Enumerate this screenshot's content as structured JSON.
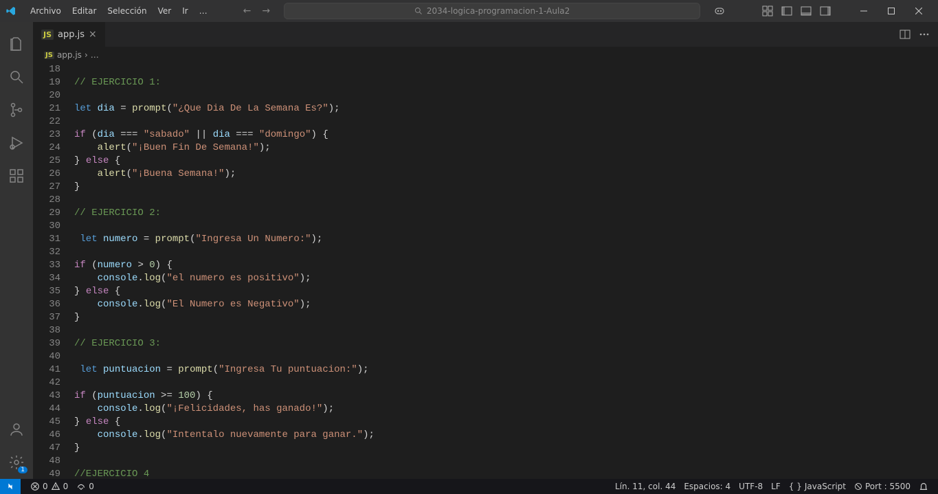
{
  "menu": [
    "Archivo",
    "Editar",
    "Selección",
    "Ver",
    "Ir",
    "…"
  ],
  "search_placeholder": "2034-logica-programacion-1-Aula2",
  "tab": {
    "label": "app.js"
  },
  "breadcrumb": {
    "file": "app.js"
  },
  "gutter_start": 18,
  "gutter_end": 49,
  "code": [
    [],
    [
      [
        "comment",
        "// EJERCICIO 1:"
      ]
    ],
    [],
    [
      [
        "keyword",
        "let"
      ],
      [
        "punct",
        " "
      ],
      [
        "var",
        "dia"
      ],
      [
        "punct",
        " = "
      ],
      [
        "func",
        "prompt"
      ],
      [
        "punct",
        "("
      ],
      [
        "string",
        "\"¿Que Dia De La Semana Es?\""
      ],
      [
        "punct",
        ");"
      ]
    ],
    [],
    [
      [
        "ctrl",
        "if"
      ],
      [
        "punct",
        " ("
      ],
      [
        "var",
        "dia"
      ],
      [
        "punct",
        " === "
      ],
      [
        "string",
        "\"sabado\""
      ],
      [
        "punct",
        " || "
      ],
      [
        "var",
        "dia"
      ],
      [
        "punct",
        " === "
      ],
      [
        "string",
        "\"domingo\""
      ],
      [
        "punct",
        ") {"
      ]
    ],
    [
      [
        "punct",
        "    "
      ],
      [
        "func",
        "alert"
      ],
      [
        "punct",
        "("
      ],
      [
        "string",
        "\"¡Buen Fin De Semana!\""
      ],
      [
        "punct",
        ");"
      ]
    ],
    [
      [
        "punct",
        "} "
      ],
      [
        "ctrl",
        "else"
      ],
      [
        "punct",
        " {"
      ]
    ],
    [
      [
        "punct",
        "    "
      ],
      [
        "func",
        "alert"
      ],
      [
        "punct",
        "("
      ],
      [
        "string",
        "\"¡Buena Semana!\""
      ],
      [
        "punct",
        ");"
      ]
    ],
    [
      [
        "punct",
        "}"
      ]
    ],
    [],
    [
      [
        "comment",
        "// EJERCICIO 2:"
      ]
    ],
    [],
    [
      [
        "punct",
        " "
      ],
      [
        "keyword",
        "let"
      ],
      [
        "punct",
        " "
      ],
      [
        "var",
        "numero"
      ],
      [
        "punct",
        " = "
      ],
      [
        "func",
        "prompt"
      ],
      [
        "punct",
        "("
      ],
      [
        "string",
        "\"Ingresa Un Numero:\""
      ],
      [
        "punct",
        ");"
      ]
    ],
    [],
    [
      [
        "ctrl",
        "if"
      ],
      [
        "punct",
        " ("
      ],
      [
        "var",
        "numero"
      ],
      [
        "punct",
        " > "
      ],
      [
        "num",
        "0"
      ],
      [
        "punct",
        ") {"
      ]
    ],
    [
      [
        "punct",
        "    "
      ],
      [
        "obj",
        "console"
      ],
      [
        "punct",
        "."
      ],
      [
        "func",
        "log"
      ],
      [
        "punct",
        "("
      ],
      [
        "string",
        "\"el numero es positivo\""
      ],
      [
        "punct",
        ");"
      ]
    ],
    [
      [
        "punct",
        "} "
      ],
      [
        "ctrl",
        "else"
      ],
      [
        "punct",
        " {"
      ]
    ],
    [
      [
        "punct",
        "    "
      ],
      [
        "obj",
        "console"
      ],
      [
        "punct",
        "."
      ],
      [
        "func",
        "log"
      ],
      [
        "punct",
        "("
      ],
      [
        "string",
        "\"El Numero es Negativo\""
      ],
      [
        "punct",
        ");"
      ]
    ],
    [
      [
        "punct",
        "}"
      ]
    ],
    [],
    [
      [
        "comment",
        "// EJERCICIO 3:"
      ]
    ],
    [],
    [
      [
        "punct",
        " "
      ],
      [
        "keyword",
        "let"
      ],
      [
        "punct",
        " "
      ],
      [
        "var",
        "puntuacion"
      ],
      [
        "punct",
        " = "
      ],
      [
        "func",
        "prompt"
      ],
      [
        "punct",
        "("
      ],
      [
        "string",
        "\"Ingresa Tu puntuacion:\""
      ],
      [
        "punct",
        ");"
      ]
    ],
    [],
    [
      [
        "ctrl",
        "if"
      ],
      [
        "punct",
        " ("
      ],
      [
        "var",
        "puntuacion"
      ],
      [
        "punct",
        " >= "
      ],
      [
        "num",
        "100"
      ],
      [
        "punct",
        ") {"
      ]
    ],
    [
      [
        "punct",
        "    "
      ],
      [
        "obj",
        "console"
      ],
      [
        "punct",
        "."
      ],
      [
        "func",
        "log"
      ],
      [
        "punct",
        "("
      ],
      [
        "string",
        "\"¡Felicidades, has ganado!\""
      ],
      [
        "punct",
        ");"
      ]
    ],
    [
      [
        "punct",
        "} "
      ],
      [
        "ctrl",
        "else"
      ],
      [
        "punct",
        " {"
      ]
    ],
    [
      [
        "punct",
        "    "
      ],
      [
        "obj",
        "console"
      ],
      [
        "punct",
        "."
      ],
      [
        "func",
        "log"
      ],
      [
        "punct",
        "("
      ],
      [
        "string",
        "\"Intentalo nuevamente para ganar.\""
      ],
      [
        "punct",
        ");"
      ]
    ],
    [
      [
        "punct",
        "}"
      ]
    ],
    [],
    [
      [
        "comment",
        "//EJERCICIO 4"
      ]
    ]
  ],
  "status": {
    "errors": "0",
    "warnings": "0",
    "ports": "0",
    "cursor": "Lín. 11, col. 44",
    "spaces": "Espacios: 4",
    "encoding": "UTF-8",
    "eol": "LF",
    "language": "JavaScript",
    "port": "Port : 5500",
    "settings_badge": "1"
  }
}
